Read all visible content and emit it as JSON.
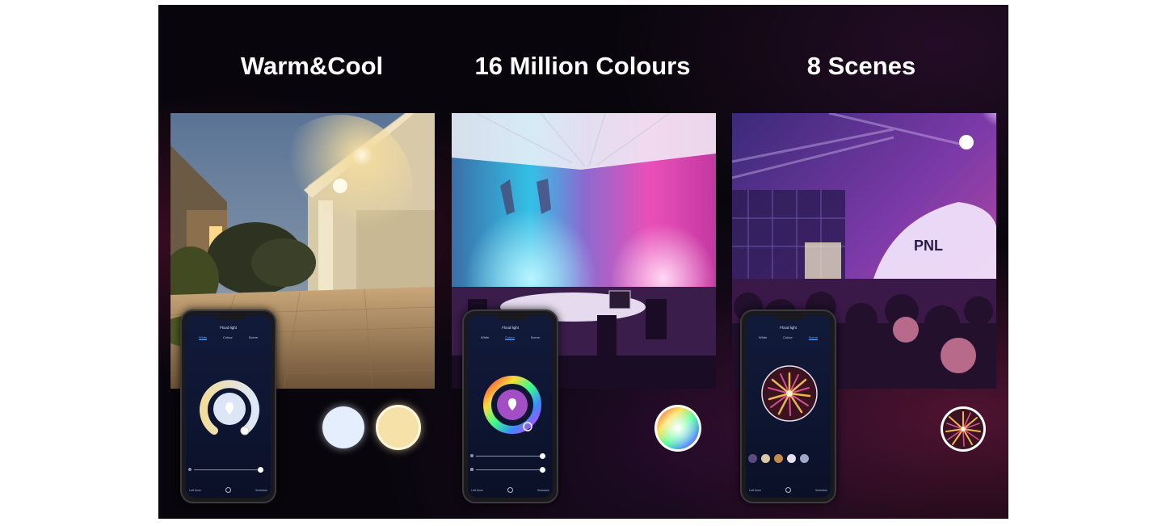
{
  "features": [
    {
      "title": "Warm&Cool",
      "app": {
        "screen_title": "Flood light",
        "tabs": [
          "White",
          "Colour",
          "Scene"
        ],
        "active_tab": "White",
        "bottom_left": "Left timer",
        "bottom_right": "Schedule"
      },
      "swatches": [
        "#e4eefc",
        "#f6e2a8"
      ]
    },
    {
      "title": "16 Million Colours",
      "app": {
        "screen_title": "Flood light",
        "tabs": [
          "White",
          "Colour",
          "Scene"
        ],
        "active_tab": "Colour",
        "bottom_left": "Left timer",
        "bottom_right": "Schedule"
      },
      "swatches": [
        "colour-wheel"
      ]
    },
    {
      "title": "8 Scenes",
      "app": {
        "screen_title": "Flood light",
        "tabs": [
          "White",
          "Colour",
          "Scene"
        ],
        "active_tab": "Scene",
        "bottom_left": "Left timer",
        "bottom_right": "Schedule"
      },
      "swatches": [
        "fireworks"
      ]
    }
  ],
  "colors": {
    "background": "#08060c",
    "title_text": "#ffffff",
    "active_tab": "#5fa8ff"
  }
}
